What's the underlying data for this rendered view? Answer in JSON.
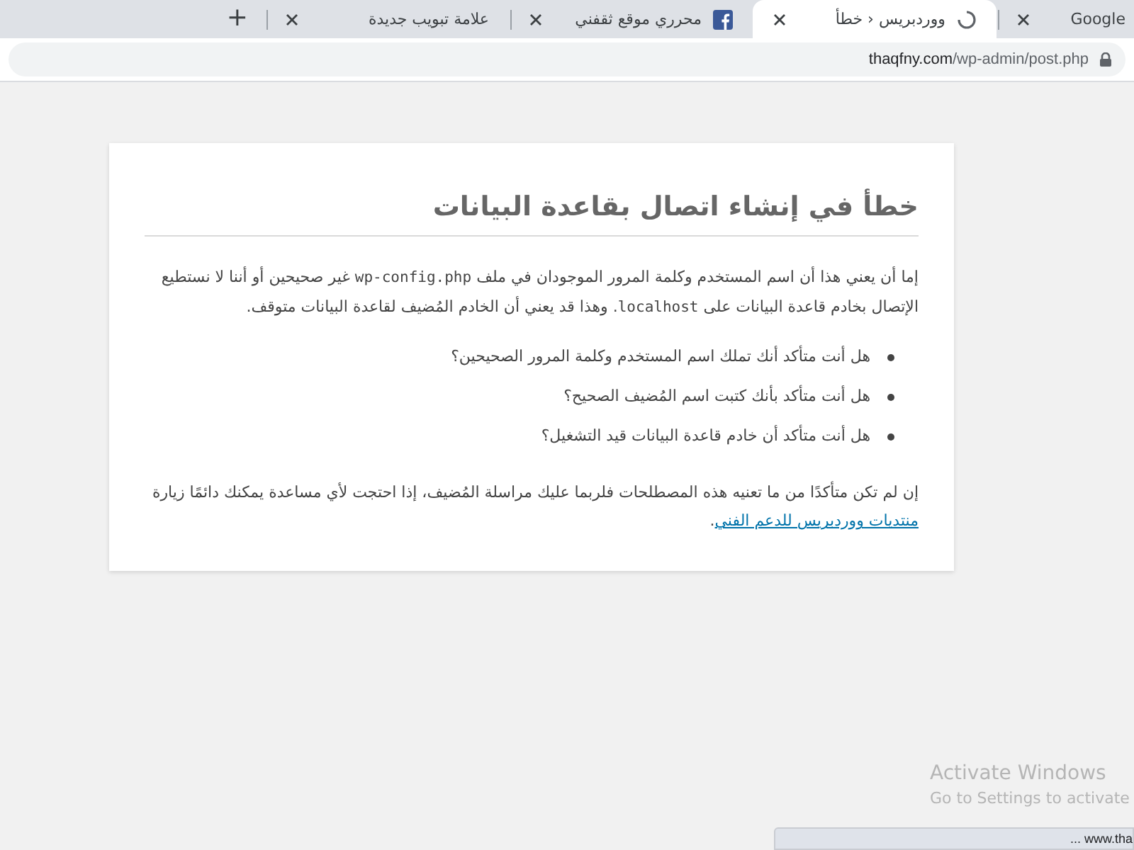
{
  "tabs": [
    {
      "title": "Google",
      "selected": false,
      "kind": "plain"
    },
    {
      "title": "ووردبريس ‹ خطأ",
      "selected": true,
      "kind": "loading"
    },
    {
      "title": "محرري موقع ثقفني",
      "selected": false,
      "kind": "facebook"
    },
    {
      "title": "علامة تبويب جديدة",
      "selected": false,
      "kind": "plain"
    }
  ],
  "new_tab": "+",
  "address": {
    "host": "thaqfny.com",
    "path": "/wp-admin/post.php",
    "secure": true
  },
  "error": {
    "title": "خطأ في إنشاء اتصال بقاعدة البيانات",
    "intro": [
      {
        "kind": "text",
        "text": "إما أن يعني هذا أن اسم المستخدم وكلمة المرور الموجودان في ملف "
      },
      {
        "kind": "code",
        "text": "wp-config.php"
      },
      {
        "kind": "text",
        "text": " غير صحيحين أو أننا لا نستطيع الإتصال بخادم قاعدة البيانات على "
      },
      {
        "kind": "code",
        "text": "localhost"
      },
      {
        "kind": "text",
        "text": ". وهذا قد يعني أن الخادم المُضيف لقاعدة البيانات متوقف."
      }
    ],
    "questions": [
      "هل أنت متأكد أنك تملك اسم المستخدم وكلمة المرور الصحيحين؟",
      "هل أنت متأكد بأنك كتبت اسم المُضيف الصحيح؟",
      "هل أنت متأكد أن خادم قاعدة البيانات قيد التشغيل؟"
    ],
    "help": "إن لم تكن متأكدًا من ما تعنيه هذه المصطلحات فلربما عليك مراسلة المُضيف، إذا احتجت لأي مساعدة يمكنك دائمًا زيارة",
    "help_link": "منتديات ووردبريس للدعم الفني",
    "help_end": "."
  },
  "activation": {
    "title": "Activate Windows",
    "text": "Go to Settings to activate"
  },
  "status_bar": "... www.tha"
}
